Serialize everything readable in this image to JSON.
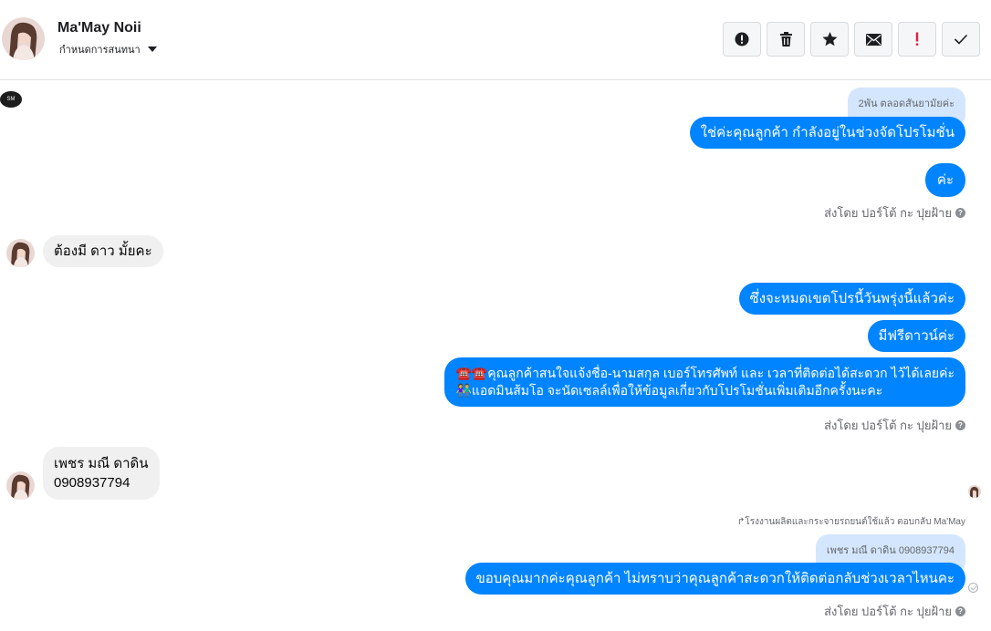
{
  "header": {
    "name": "Ma'May Noii",
    "subtitle": "กำหนดการสนทนา",
    "toolbar": {
      "spam": "report-icon",
      "delete": "trash-icon",
      "star": "star-icon",
      "unread": "envelope-icon",
      "important": "exclamation-icon",
      "done": "check-icon"
    }
  },
  "page_logo_text": "SM",
  "messages": {
    "quote1": "2พัน ตลอดสันยามัยค่ะ",
    "out1": "ใช่ค่ะคุณลูกค้า กำลังอยู่ในช่วงจัดโปรโมชั่น",
    "out2": "ค่ะ",
    "sent_by_1": "ส่งโดย ปอร์โต้ กะ ปุยฝ้าย",
    "in1": "ต้องมี ดาว มั้ยคะ",
    "out3": "ซึ่งจะหมดเขตโปรนี้วันพรุ่งนี้แล้วค่ะ",
    "out4": "มีฟรีดาวน์ค่ะ",
    "out5_line1": "☎️☎️คุณลูกค้าสนใจแจ้งชื่อ-นามสกุล เบอร์โทรศัพท์ และ เวลาที่ติดต่อได้สะดวก ไว้ได้เลยค่ะ",
    "out5_line2": "👫แอดมินส้มโอ จะนัดเซลล์เพื่อให้ข้อมูลเกี่ยวกับโปรโมชั่นเพิ่มเติมอีกครั้งนะคะ",
    "sent_by_2": "ส่งโดย ปอร์โต้ กะ ปุยฝ้าย",
    "in2_line1": "เพชร มณี ดาดิน",
    "in2_line2": "0908937794",
    "reply_note": "↱โรงงานผลิตและกระจายรถยนต์ใช้แล้ว ตอบกลับ Ma'May",
    "quote2": "เพชร มณี ดาดิน 0908937794",
    "out6": "ขอบคุณมากค่ะคุณลูกค้า ไม่ทราบว่าคุณลูกค้าสะดวกให้ติดต่อกลับช่วงเวลาไหนคะ",
    "sent_by_3": "ส่งโดย ปอร์โต้ กะ ปุยฝ้าย"
  },
  "colors": {
    "outgoing_bubble": "#0084ff",
    "incoming_bubble": "#f0f0f0",
    "quote_bubble": "#d3e6fd",
    "important_icon": "#e41e3f"
  }
}
